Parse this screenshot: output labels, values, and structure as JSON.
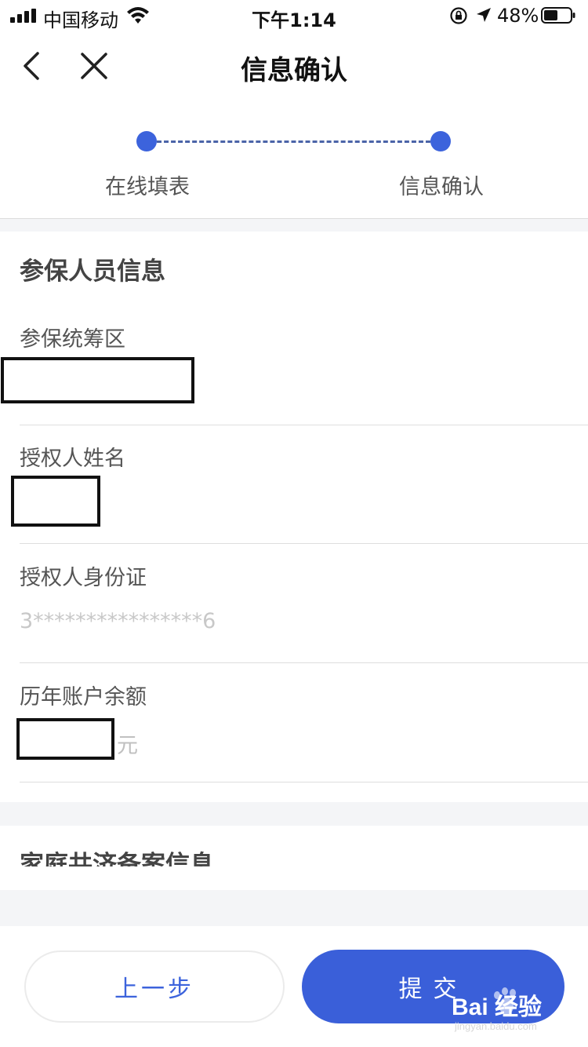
{
  "status_bar": {
    "carrier": "中国移动",
    "time": "下午1:14",
    "battery_percent": "48%",
    "battery_level": 0.48,
    "icons": [
      "signal-icon",
      "wifi-icon",
      "rotation-lock-icon",
      "location-icon",
      "battery-icon"
    ]
  },
  "nav": {
    "title": "信息确认",
    "icons": [
      "back-icon",
      "close-icon"
    ]
  },
  "stepper": {
    "steps": [
      {
        "label": "在线填表"
      },
      {
        "label": "信息确认"
      }
    ],
    "active_color": "#3c63dc"
  },
  "section": {
    "title": "参保人员信息",
    "fields": [
      {
        "label": "参保统筹区",
        "value": ""
      },
      {
        "label": "授权人姓名",
        "value": ""
      },
      {
        "label": "授权人身份证",
        "value": "3****************6"
      },
      {
        "label": "历年账户余额",
        "value": "",
        "unit": "元"
      }
    ]
  },
  "section2": {
    "title": "家庭共济备案信息"
  },
  "footer": {
    "prev_label": "上一步",
    "submit_label": "提交"
  },
  "watermark": {
    "text": "Bai 经验",
    "sub": "jingyan.baidu.com"
  },
  "colors": {
    "primary": "#3a5fd9",
    "divider": "#dedede",
    "gap_bg": "#f4f5f7"
  }
}
